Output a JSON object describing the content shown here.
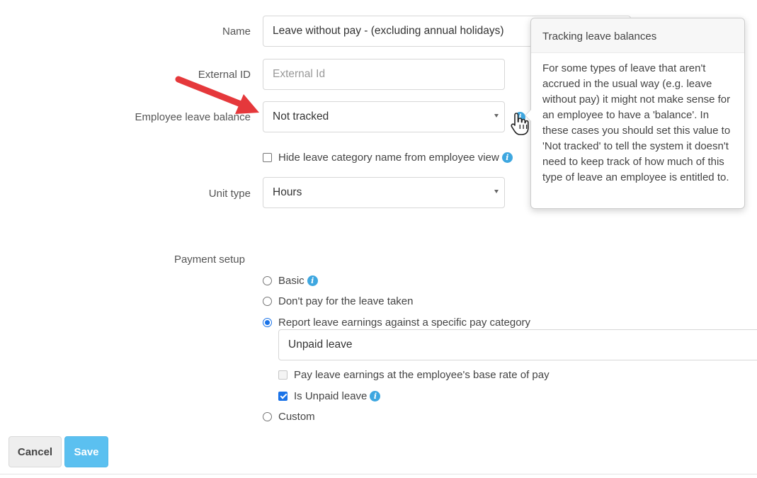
{
  "form": {
    "name_label": "Name",
    "name_value": "Leave without pay - (excluding annual holidays)",
    "external_id_label": "External ID",
    "external_id_placeholder": "External Id",
    "leave_balance_label": "Employee leave balance",
    "leave_balance_value": "Not tracked",
    "hide_name_label": "Hide leave category name from employee view",
    "unit_type_label": "Unit type",
    "unit_type_value": "Hours",
    "payment_setup_label": "Payment setup"
  },
  "payment_options": {
    "basic": "Basic",
    "dont_pay": "Don't pay for the leave taken",
    "report_earnings": "Report leave earnings against a specific pay category",
    "pay_category_value": "Unpaid leave",
    "base_rate": "Pay leave earnings at the employee's base rate of pay",
    "is_unpaid": "Is Unpaid leave",
    "custom": "Custom",
    "selected": "report_earnings"
  },
  "tooltip": {
    "title": "Tracking leave balances",
    "body": "For some types of leave that aren't accrued in the usual way (e.g. leave without pay) it might not make sense for an employee to have a 'balance'. In these cases you should set this value to 'Not tracked' to tell the system it doesn't need to keep track of how much of this type of leave an employee is entitled to."
  },
  "buttons": {
    "cancel": "Cancel",
    "save": "Save"
  },
  "icons": {
    "info": "info-icon",
    "pointer": "hand-pointer-cursor",
    "annotation_arrow": "red-arrow"
  },
  "colors": {
    "accent": "#3ea7e0",
    "save": "#5bc0f0",
    "arrow": "#e5383b"
  }
}
